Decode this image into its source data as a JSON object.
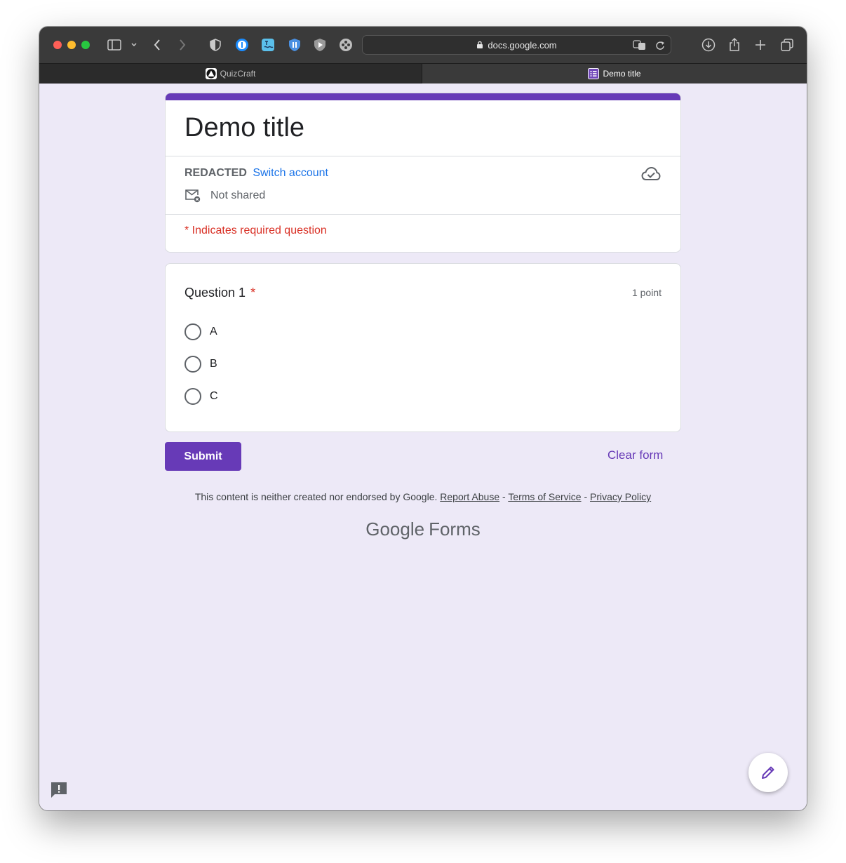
{
  "browser": {
    "url": "docs.google.com",
    "tabs": [
      {
        "label": "QuizCraft",
        "icon": "quizcraft-logo-icon",
        "active": false
      },
      {
        "label": "Demo title",
        "icon": "google-forms-icon",
        "active": true
      }
    ]
  },
  "form": {
    "title": "Demo title",
    "account_name": "REDACTED",
    "switch_account": "Switch account",
    "share_status": "Not shared",
    "required_note": "* Indicates required question",
    "question": {
      "title": "Question 1",
      "required_mark": "*",
      "points": "1 point",
      "options": [
        "A",
        "B",
        "C"
      ]
    },
    "submit_label": "Submit",
    "clear_label": "Clear form"
  },
  "footer": {
    "disclaimer": "This content is neither created nor endorsed by Google.",
    "report_abuse": "Report Abuse",
    "separator": "-",
    "terms": "Terms of Service",
    "privacy": "Privacy Policy",
    "brand_google": "Google",
    "brand_forms": "Forms"
  },
  "colors": {
    "accent": "#673ab7",
    "page_bg": "#ede9f7",
    "required_red": "#d93025",
    "link_blue": "#1a73e8"
  }
}
